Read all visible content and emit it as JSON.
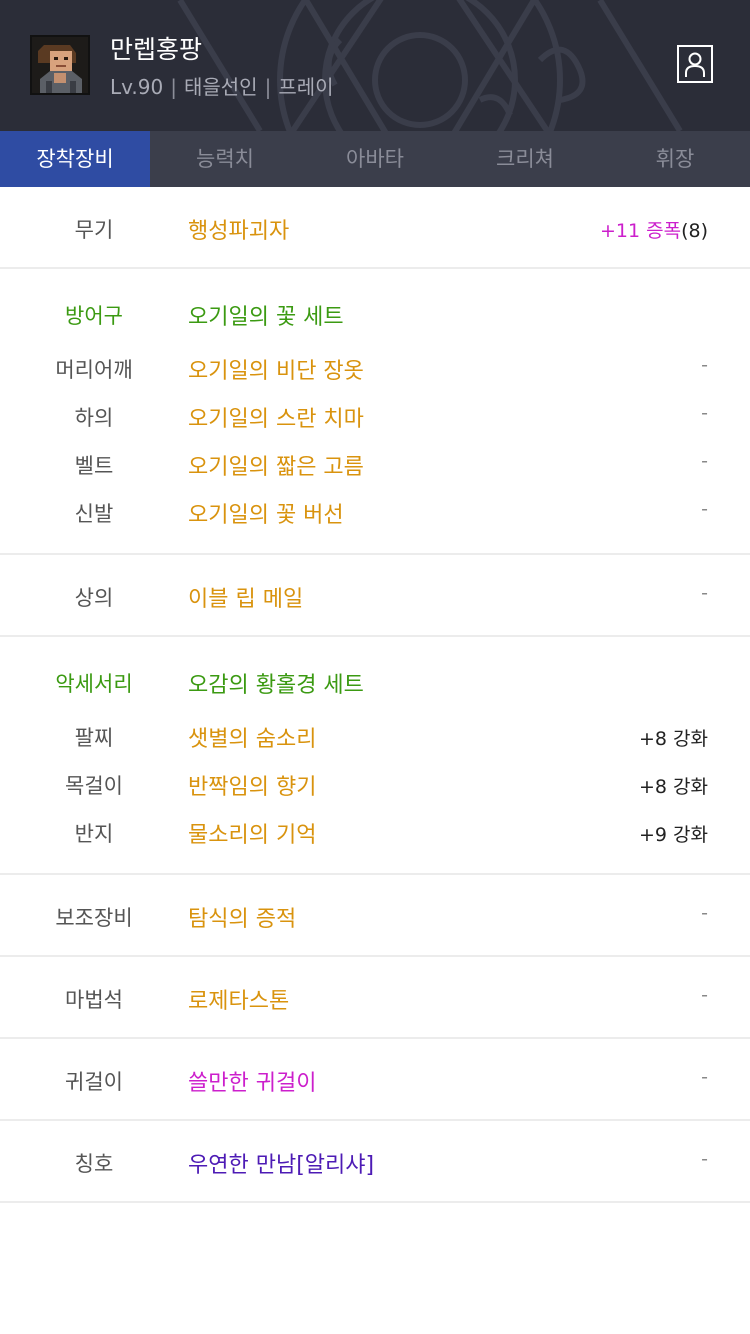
{
  "header": {
    "name": "만렙홍팡",
    "level": "Lv.90",
    "job": "태을선인",
    "server": "프레이"
  },
  "tabs": [
    "장착장비",
    "능력치",
    "아바타",
    "크리쳐",
    "휘장"
  ],
  "weapon": {
    "slot": "무기",
    "item": "행성파괴자",
    "amp_label": "+11 증폭",
    "amp_count": "(8)"
  },
  "armor": {
    "group_label": "방어구",
    "set_name": "오기일의 꽃 세트",
    "rows": [
      {
        "slot": "머리어깨",
        "item": "오기일의 비단 장옷",
        "extra": "-"
      },
      {
        "slot": "하의",
        "item": "오기일의 스란 치마",
        "extra": "-"
      },
      {
        "slot": "벨트",
        "item": "오기일의 짧은 고름",
        "extra": "-"
      },
      {
        "slot": "신발",
        "item": "오기일의 꽃 버선",
        "extra": "-"
      }
    ]
  },
  "top": {
    "slot": "상의",
    "item": "이블 립 메일",
    "extra": "-"
  },
  "accessory": {
    "group_label": "악세서리",
    "set_name": "오감의 황홀경 세트",
    "rows": [
      {
        "slot": "팔찌",
        "item": "샛별의 숨소리",
        "extra": "+8 강화"
      },
      {
        "slot": "목걸이",
        "item": "반짝임의 향기",
        "extra": "+8 강화"
      },
      {
        "slot": "반지",
        "item": "물소리의 기억",
        "extra": "+9 강화"
      }
    ]
  },
  "sub": {
    "slot": "보조장비",
    "item": "탐식의 증적",
    "extra": "-"
  },
  "magic": {
    "slot": "마법석",
    "item": "로제타스톤",
    "extra": "-"
  },
  "earring": {
    "slot": "귀걸이",
    "item": "쓸만한 귀걸이",
    "extra": "-"
  },
  "title": {
    "slot": "칭호",
    "item": "우연한 만남[알리샤]",
    "extra": "-"
  },
  "colors": {
    "header_bg": "#2b2d38",
    "tab_bg": "#3b3e4b",
    "tab_active": "#2f4ca3",
    "item_unique": "#d9930e",
    "set_green": "#3b9a12",
    "rare_magenta": "#cc1fcc",
    "title_purple": "#4d1bb5"
  },
  "icons": [
    "character-portrait",
    "profile-card-icon"
  ]
}
